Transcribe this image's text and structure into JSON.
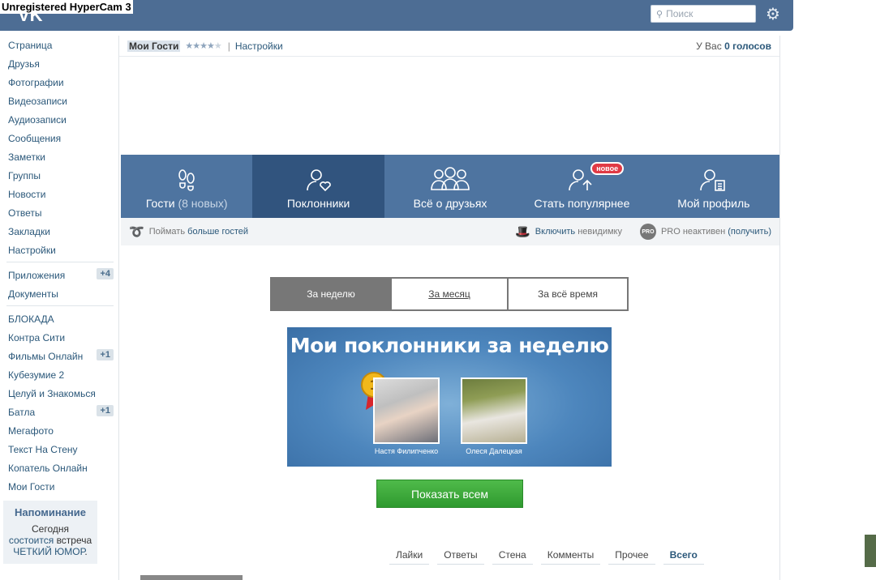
{
  "watermark": "Unregistered HyperCam 3",
  "topbar": {
    "search_placeholder": "Поиск"
  },
  "sidebar": {
    "items": [
      {
        "label": "Страница"
      },
      {
        "label": "Друзья"
      },
      {
        "label": "Фотографии"
      },
      {
        "label": "Видеозаписи"
      },
      {
        "label": "Аудиозаписи"
      },
      {
        "label": "Сообщения"
      },
      {
        "label": "Заметки"
      },
      {
        "label": "Группы"
      },
      {
        "label": "Новости"
      },
      {
        "label": "Ответы"
      },
      {
        "label": "Закладки"
      },
      {
        "label": "Настройки"
      }
    ],
    "apps": [
      {
        "label": "Приложения",
        "count": "+4"
      },
      {
        "label": "Документы"
      }
    ],
    "games": [
      {
        "label": "БЛОКАДА"
      },
      {
        "label": "Контра Сити"
      },
      {
        "label": "Фильмы Онлайн",
        "count": "+1"
      },
      {
        "label": "Кубезумие 2"
      },
      {
        "label": "Целуй и Знакомься"
      },
      {
        "label": "Батла",
        "count": "+1"
      },
      {
        "label": "Мегафото"
      },
      {
        "label": "Текст На Стену"
      },
      {
        "label": "Копатель Онлайн"
      },
      {
        "label": "Мои Гости"
      }
    ],
    "reminder": {
      "title": "Напоминание",
      "text_1": "Сегодня",
      "hl_1": "состоится",
      "text_2": "встреча",
      "hl_2": "ЧЕТКИЙ ЮМОР",
      "text_3": "."
    }
  },
  "app_header": {
    "title": "Мои Гости",
    "rating_stars": 4,
    "settings_label": "Настройки",
    "votes_prefix": "У Вас",
    "votes_count": "0",
    "votes_suffix": "голосов"
  },
  "nav_tabs": [
    {
      "label": "Гости",
      "extra": "(8 новых)"
    },
    {
      "label": "Поклонники"
    },
    {
      "label": "Всё о друзьях"
    },
    {
      "label": "Стать популярнее",
      "badge": "новое"
    },
    {
      "label": "Мой профиль"
    }
  ],
  "toolbar": {
    "catch_prefix": "Поймать",
    "catch_link": "больше гостей",
    "invisible_link": "Включить",
    "invisible_rest": "невидимку",
    "pro_icon": "PRO",
    "pro_status": "PRO неактивен",
    "pro_link": "(получить)"
  },
  "period_tabs": [
    "За неделю",
    "За месяц",
    "За всё время"
  ],
  "banner": {
    "title": "Мои поклонники за неделю",
    "medal": "1",
    "fans": [
      {
        "name": "Настя Филипченко"
      },
      {
        "name": "Олеся Далецкая"
      }
    ]
  },
  "show_all_label": "Показать всем",
  "stat_tabs": [
    "Лайки",
    "Ответы",
    "Стена",
    "Комменты",
    "Прочее",
    "Всего"
  ],
  "colors": {
    "header": "#4d6d94",
    "tab_bar": "#4e74a0",
    "tab_active": "#31547e",
    "link": "#2b587a",
    "button_green": "#3aa83a",
    "badge_red": "#e03a45"
  }
}
